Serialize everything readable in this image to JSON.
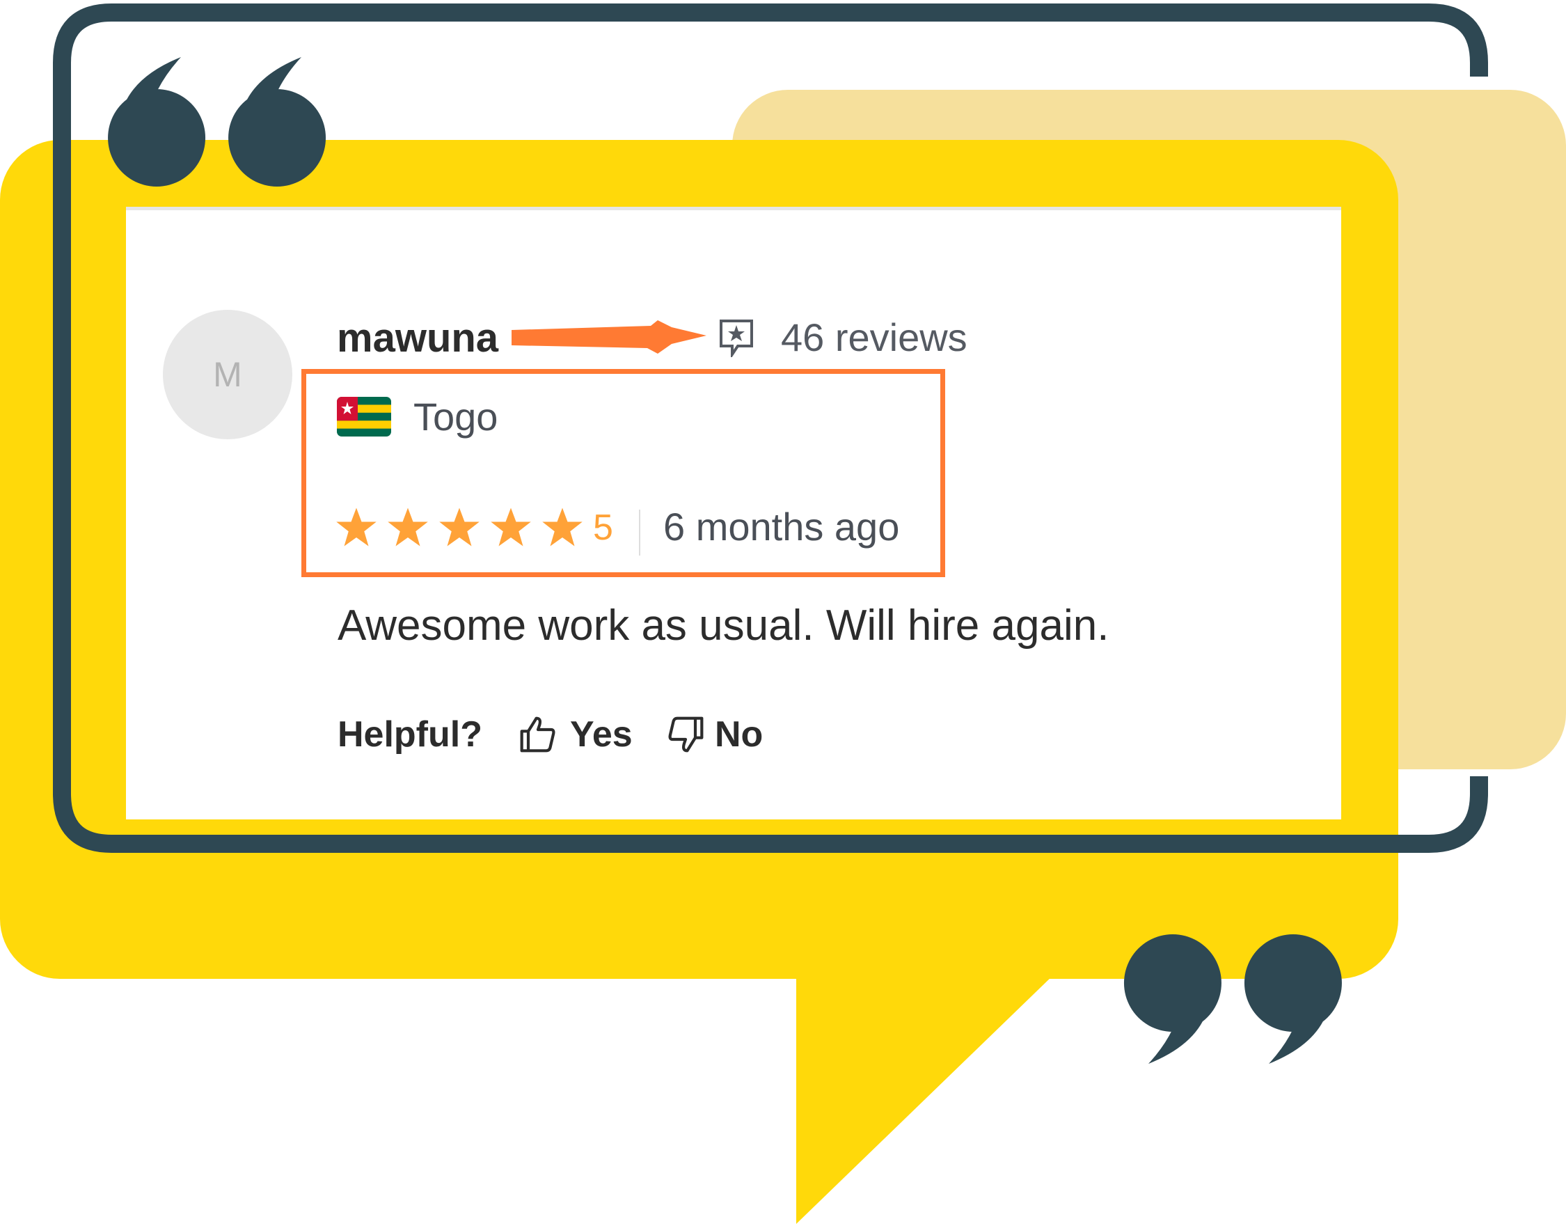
{
  "colors": {
    "yellow": "#ffd90a",
    "light_yellow": "#f6e09c",
    "frame": "#2e4853",
    "highlight": "#ff7a33",
    "star": "#ffa238"
  },
  "review": {
    "avatar_initial": "M",
    "reviewer_name": "mawuna",
    "reviews_icon": "star-speech-bubble-icon",
    "reviews_count": "46 reviews",
    "country": "Togo",
    "flag": "togo-flag",
    "rating": 5,
    "rating_label": "5",
    "time_ago": "6 months ago",
    "text": "Awesome work as usual. Will hire again."
  },
  "helpful": {
    "label": "Helpful?",
    "yes_label": "Yes",
    "no_label": "No"
  }
}
